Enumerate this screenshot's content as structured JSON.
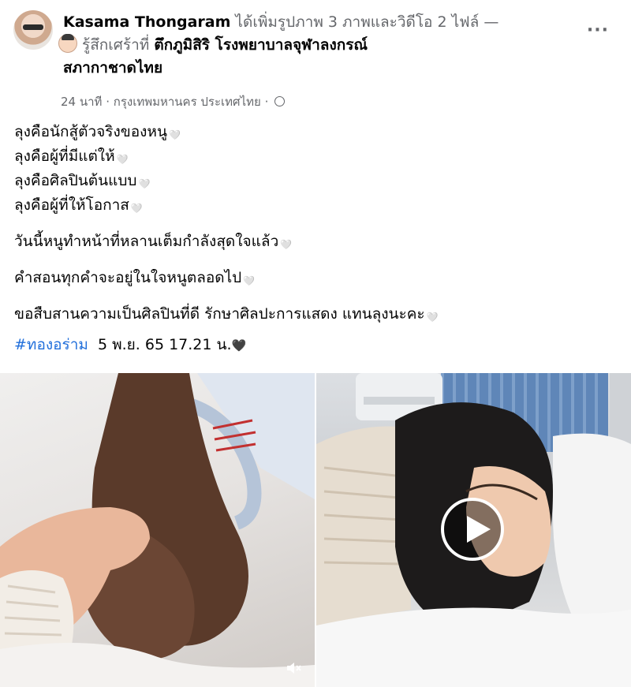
{
  "header": {
    "author": "Kasama Thongaram",
    "action": " ได้เพิ่มรูปภาพ 3 ภาพและวิดีโอ 2 ไฟล์ —",
    "feeling_prefix": "รู้สึกเศร้าที่ ",
    "place_line1": "ตึกภูมิสิริ โรงพยาบาลจุฬาลงกรณ์",
    "place_line2": "สภากาชาดไทย",
    "time": "24 นาที",
    "sep": " · ",
    "location": "กรุงเทพมหานคร ประเทศไทย",
    "sep2": " · ",
    "more": "···"
  },
  "body": {
    "lines": [
      "ลุงคือนักสู้ตัวจริงของหนู",
      "ลุงคือผู้ที่มีแต่ให้",
      "ลุงคือศิลปินต้นแบบ",
      "ลุงคือผู้ที่ให้โอกาส"
    ],
    "para2": "วันนี้หนูทำหน้าที่หลานเต็มกำลังสุดใจแล้ว",
    "para3": "คำสอนทุกคำจะอยู่ในใจหนูตลอดไป",
    "para4": "ขอสืบสานความเป็นศิลปินที่ดี รักษาศิลปะการแสดง แทนลุงนะคะ",
    "hashtag": "#ทองอร่าม",
    "date": "5 พ.ย. 65 17.21 น.",
    "heart": "🤍",
    "dark_heart": "🖤"
  },
  "icons": {
    "globe": "globe-icon",
    "play": "play-icon",
    "volume": "volume-icon"
  }
}
